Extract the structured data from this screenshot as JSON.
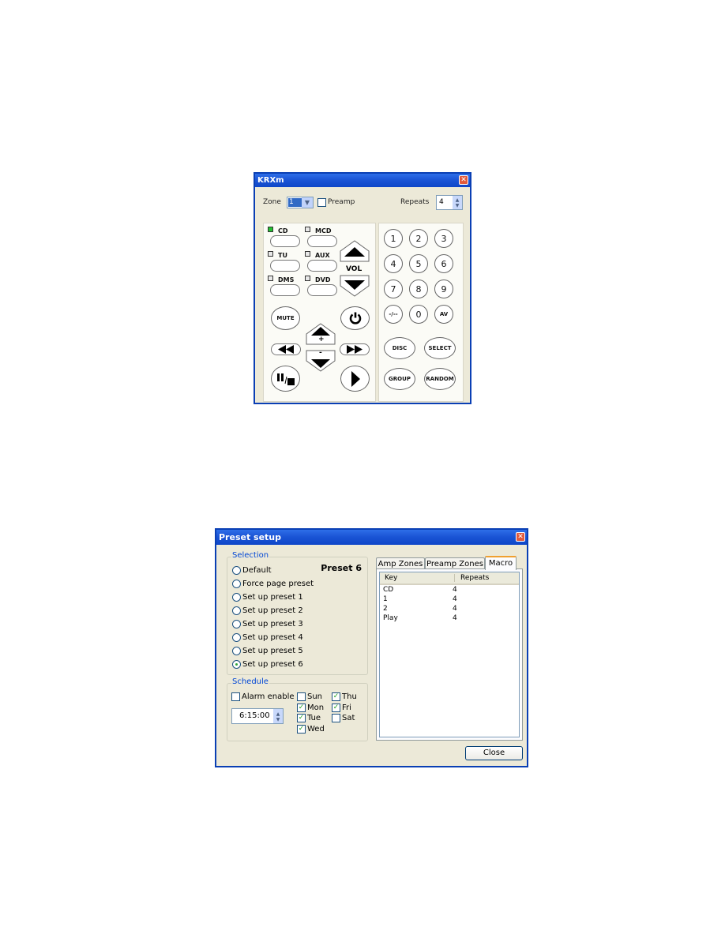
{
  "krxm": {
    "title": "KRXm",
    "zone_label": "Zone",
    "zone_value": "1",
    "preamp_label": "Preamp",
    "preamp_checked": false,
    "repeats_label": "Repeats",
    "repeats_value": "4",
    "sources": [
      {
        "label": "CD",
        "active": true
      },
      {
        "label": "MCD",
        "active": false
      },
      {
        "label": "TU",
        "active": false
      },
      {
        "label": "AUX",
        "active": false
      },
      {
        "label": "DMS",
        "active": false
      },
      {
        "label": "DVD",
        "active": false
      }
    ],
    "vol_label": "VOL",
    "mute_label": "MUTE",
    "plus_label": "+",
    "minus_label": "-",
    "keypad": [
      "1",
      "2",
      "3",
      "4",
      "5",
      "6",
      "7",
      "8",
      "9",
      "-/--",
      "0",
      "AV"
    ],
    "func_buttons": [
      "DISC",
      "SELECT",
      "GROUP",
      "RANDOM"
    ],
    "icons": {
      "power": "power-icon",
      "rewind": "rewind-icon",
      "fast_forward": "fast-forward-icon",
      "pause_stop": "pause-stop-icon",
      "play": "play-icon",
      "vol_up": "triangle-up-icon",
      "vol_down": "triangle-down-icon"
    }
  },
  "preset": {
    "title": "Preset setup",
    "selection_label": "Selection",
    "preset_name": "Preset 6",
    "options": [
      {
        "label": "Default",
        "selected": false
      },
      {
        "label": "Force page preset",
        "selected": false
      },
      {
        "label": "Set up preset 1",
        "selected": false
      },
      {
        "label": "Set up preset 2",
        "selected": false
      },
      {
        "label": "Set up preset 3",
        "selected": false
      },
      {
        "label": "Set up preset 4",
        "selected": false
      },
      {
        "label": "Set up preset 5",
        "selected": false
      },
      {
        "label": "Set up preset 6",
        "selected": true
      }
    ],
    "schedule_label": "Schedule",
    "alarm_label": "Alarm enable",
    "alarm_checked": false,
    "time_value": "6:15:00",
    "days": [
      {
        "label": "Sun",
        "checked": false
      },
      {
        "label": "Mon",
        "checked": true
      },
      {
        "label": "Tue",
        "checked": true
      },
      {
        "label": "Wed",
        "checked": true
      },
      {
        "label": "Thu",
        "checked": true
      },
      {
        "label": "Fri",
        "checked": true
      },
      {
        "label": "Sat",
        "checked": false
      }
    ],
    "tabs": [
      {
        "label": "Amp Zones",
        "active": false
      },
      {
        "label": "Preamp Zones",
        "active": false
      },
      {
        "label": "Macro",
        "active": true
      }
    ],
    "columns": [
      "Key",
      "Repeats"
    ],
    "rows": [
      {
        "key": "CD",
        "repeats": "4"
      },
      {
        "key": "1",
        "repeats": "4"
      },
      {
        "key": "2",
        "repeats": "4"
      },
      {
        "key": "Play",
        "repeats": "4"
      }
    ],
    "close_label": "Close"
  }
}
